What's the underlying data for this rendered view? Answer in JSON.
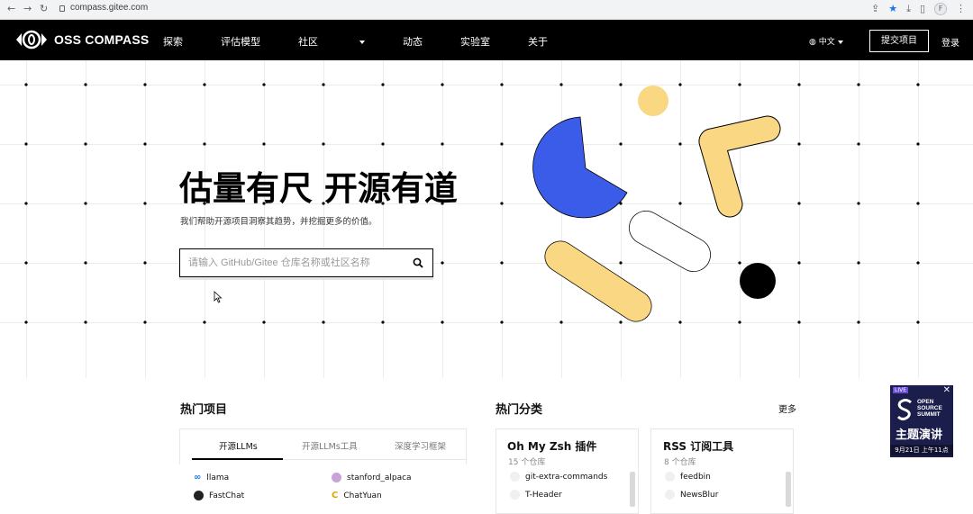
{
  "browser": {
    "url": "compass.gitee.com",
    "profile_initial": "F"
  },
  "nav": {
    "logo_text": "OSS COMPASS",
    "items": [
      "探索",
      "评估模型",
      "社区",
      "动态",
      "实验室",
      "关于"
    ],
    "language": "中文",
    "submit_label": "提交项目",
    "login_label": "登录"
  },
  "hero": {
    "title": "估量有尺 开源有道",
    "subtitle": "我们帮助开源项目洞察其趋势，并挖掘更多的价值。",
    "search_placeholder": "请输入 GitHub/Gitee 仓库名称或社区名称"
  },
  "hot_projects": {
    "title": "热门项目",
    "tabs": [
      "开源LLMs",
      "开源LLMs工具",
      "深度学习框架"
    ],
    "active_tab": 0,
    "items": [
      {
        "name": "llama",
        "icon": "meta-icon"
      },
      {
        "name": "stanford_alpaca",
        "icon": "alpaca-icon"
      },
      {
        "name": "FastChat",
        "icon": "fastchat-icon"
      },
      {
        "name": "ChatYuan",
        "icon": "chatyuan-icon"
      }
    ]
  },
  "hot_categories": {
    "title": "热门分类",
    "more_label": "更多",
    "cards": [
      {
        "title": "Oh My Zsh 插件",
        "count": "15 个仓库",
        "items": [
          "git-extra-commands",
          "T-Header"
        ]
      },
      {
        "title": "RSS 订阅工具",
        "count": "8 个仓库",
        "items": [
          "feedbin",
          "NewsBlur"
        ]
      }
    ]
  },
  "ad": {
    "live_label": "LIVE",
    "headline": "OPEN SOURCE SUMMIT",
    "title": "主题演讲",
    "date": "9月21日 上午11点"
  },
  "colors": {
    "blue": "#3b5ce8",
    "yellow": "#fad883",
    "black": "#000000"
  }
}
